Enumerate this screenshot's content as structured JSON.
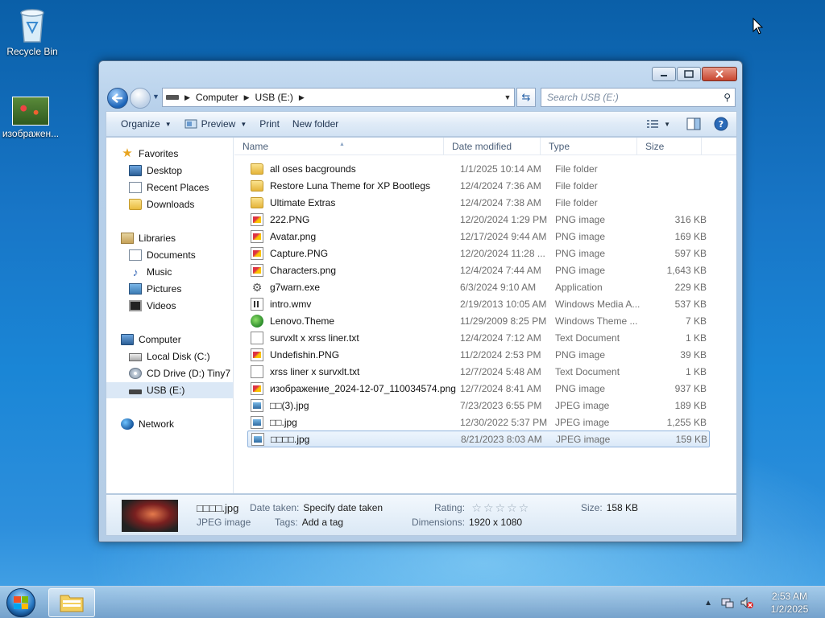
{
  "desktop": {
    "icons": [
      {
        "label": "Recycle Bin",
        "icon": "recycle-bin-icon"
      },
      {
        "label": "изображен...",
        "icon": "image-file-icon"
      }
    ]
  },
  "window": {
    "controls": {
      "minimize": "minimize",
      "maximize": "maximize",
      "close": "close"
    }
  },
  "address": {
    "crumbs": [
      "Computer",
      "USB (E:)"
    ],
    "search_placeholder": "Search USB (E:)"
  },
  "toolbar": {
    "organize": "Organize",
    "preview": "Preview",
    "print": "Print",
    "new_folder": "New folder"
  },
  "nav": {
    "favorites": {
      "label": "Favorites",
      "items": [
        "Desktop",
        "Recent Places",
        "Downloads"
      ]
    },
    "libraries": {
      "label": "Libraries",
      "items": [
        "Documents",
        "Music",
        "Pictures",
        "Videos"
      ]
    },
    "computer": {
      "label": "Computer",
      "items": [
        "Local Disk (C:)",
        "CD Drive (D:) Tiny7 x",
        "USB (E:)"
      ]
    },
    "network": {
      "label": "Network"
    }
  },
  "columns": {
    "name": "Name",
    "date": "Date modified",
    "type": "Type",
    "size": "Size"
  },
  "files": [
    {
      "name": "all oses bacgrounds",
      "date": "1/1/2025 10:14 AM",
      "type": "File folder",
      "size": "",
      "icon": "folder"
    },
    {
      "name": "Restore Luna Theme for XP Bootlegs",
      "date": "12/4/2024 7:36 AM",
      "type": "File folder",
      "size": "",
      "icon": "folder"
    },
    {
      "name": "Ultimate Extras",
      "date": "12/4/2024 7:38 AM",
      "type": "File folder",
      "size": "",
      "icon": "folder"
    },
    {
      "name": "222.PNG",
      "date": "12/20/2024 1:29 PM",
      "type": "PNG image",
      "size": "316 KB",
      "icon": "png"
    },
    {
      "name": "Avatar.png",
      "date": "12/17/2024 9:44 AM",
      "type": "PNG image",
      "size": "169 KB",
      "icon": "png"
    },
    {
      "name": "Capture.PNG",
      "date": "12/20/2024 11:28 ...",
      "type": "PNG image",
      "size": "597 KB",
      "icon": "png"
    },
    {
      "name": "Characters.png",
      "date": "12/4/2024 7:44 AM",
      "type": "PNG image",
      "size": "1,643 KB",
      "icon": "png"
    },
    {
      "name": "g7warn.exe",
      "date": "6/3/2024 9:10 AM",
      "type": "Application",
      "size": "229 KB",
      "icon": "exe"
    },
    {
      "name": "intro.wmv",
      "date": "2/19/2013 10:05 AM",
      "type": "Windows Media A...",
      "size": "537 KB",
      "icon": "wmv"
    },
    {
      "name": "Lenovo.Theme",
      "date": "11/29/2009 8:25 PM",
      "type": "Windows Theme ...",
      "size": "7 KB",
      "icon": "theme"
    },
    {
      "name": "survxlt x xrss liner.txt",
      "date": "12/4/2024 7:12 AM",
      "type": "Text Document",
      "size": "1 KB",
      "icon": "txt"
    },
    {
      "name": "Undefishin.PNG",
      "date": "11/2/2024 2:53 PM",
      "type": "PNG image",
      "size": "39 KB",
      "icon": "png"
    },
    {
      "name": "xrss liner x survxlt.txt",
      "date": "12/7/2024 5:48 AM",
      "type": "Text Document",
      "size": "1 KB",
      "icon": "txt"
    },
    {
      "name": "изображение_2024-12-07_110034574.png",
      "date": "12/7/2024 8:41 AM",
      "type": "PNG image",
      "size": "937 KB",
      "icon": "png"
    },
    {
      "name": "□□(3).jpg",
      "date": "7/23/2023 6:55 PM",
      "type": "JPEG image",
      "size": "189 KB",
      "icon": "jpg"
    },
    {
      "name": "□□.jpg",
      "date": "12/30/2022 5:37 PM",
      "type": "JPEG image",
      "size": "1,255 KB",
      "icon": "jpg"
    },
    {
      "name": "□□□□.jpg",
      "date": "8/21/2023 8:03 AM",
      "type": "JPEG image",
      "size": "159 KB",
      "icon": "jpg",
      "selected": true
    }
  ],
  "details": {
    "filename": "□□□□.jpg",
    "filetype": "JPEG image",
    "date_taken_label": "Date taken:",
    "date_taken_value": "Specify date taken",
    "tags_label": "Tags:",
    "tags_value": "Add a tag",
    "rating_label": "Rating:",
    "dimensions_label": "Dimensions:",
    "dimensions_value": "1920 x 1080",
    "size_label": "Size:",
    "size_value": "158 KB"
  },
  "taskbar": {
    "time": "2:53 AM",
    "date": "1/2/2025"
  }
}
